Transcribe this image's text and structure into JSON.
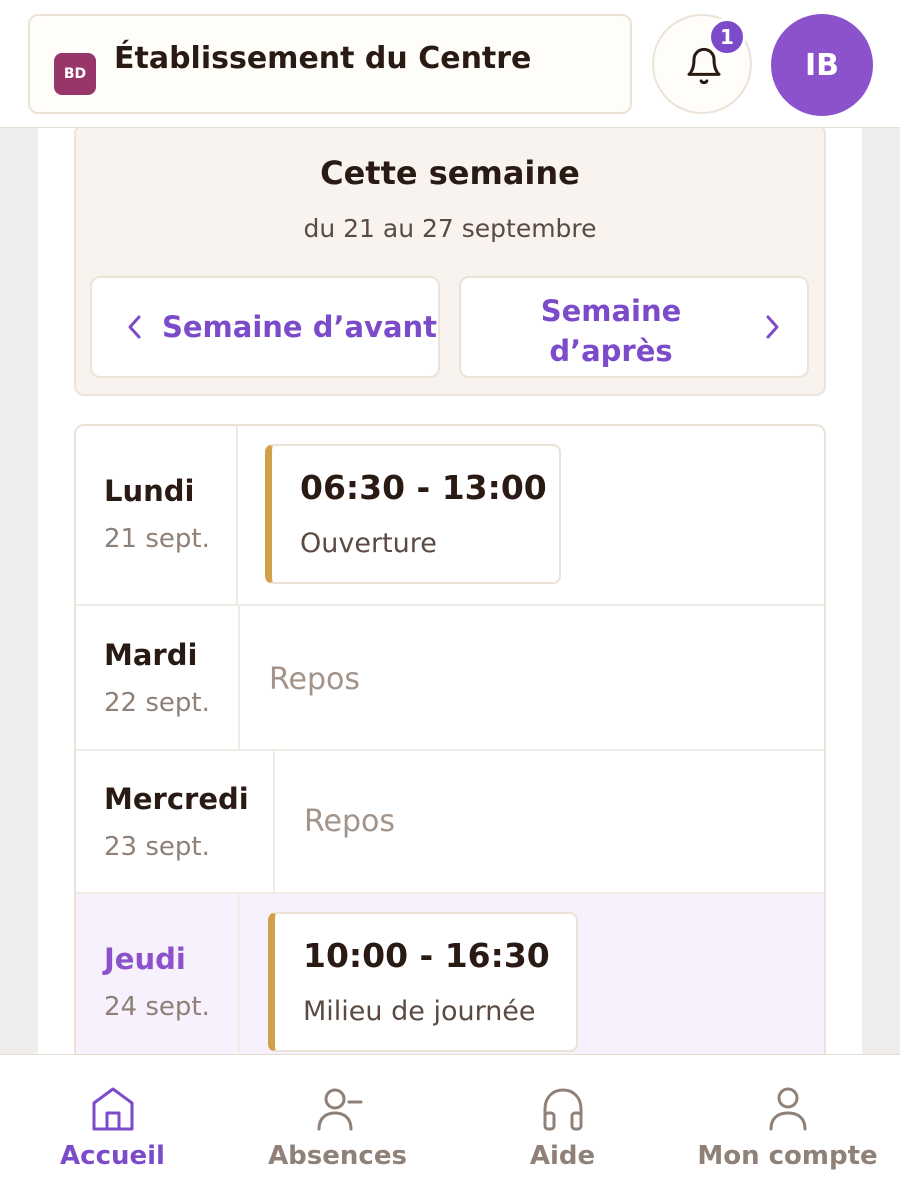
{
  "header": {
    "org_badge": "BD",
    "org_name": "Établissement du Centre",
    "notification_count": "1",
    "avatar_initials": "IB"
  },
  "week": {
    "title": "Cette semaine",
    "range": "du 21 au 27 septembre",
    "prev_label": "Semaine d’avant",
    "next_label": "Semaine d’après"
  },
  "days": [
    {
      "name": "Lundi",
      "date": "21 sept.",
      "shift_time": "06:30 - 13:00",
      "shift_label": "Ouverture"
    },
    {
      "name": "Mardi",
      "date": "22 sept.",
      "status": "Repos"
    },
    {
      "name": "Mercredi",
      "date": "23 sept.",
      "status": "Repos"
    },
    {
      "name": "Jeudi",
      "date": "24 sept.",
      "shift_time": "10:00 - 16:30",
      "shift_label": "Milieu de journée",
      "is_today": true
    }
  ],
  "bottom_nav": [
    {
      "label": "Accueil",
      "icon": "home-icon",
      "active": true
    },
    {
      "label": "Absences",
      "icon": "user-minus-icon"
    },
    {
      "label": "Aide",
      "icon": "headphones-icon"
    },
    {
      "label": "Mon compte",
      "icon": "user-icon"
    }
  ],
  "colors": {
    "accent": "#7c4bc9",
    "shift_bar": "#d0a04a",
    "badge": "#98366a"
  }
}
